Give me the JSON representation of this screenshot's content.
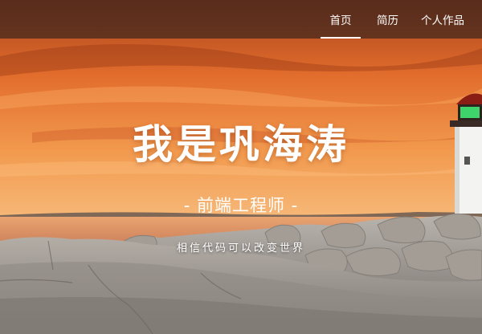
{
  "nav": {
    "items": [
      {
        "label": "首页",
        "active": true
      },
      {
        "label": "简历",
        "active": false
      },
      {
        "label": "个人作品",
        "active": false
      }
    ]
  },
  "hero": {
    "title": "我是巩海涛",
    "subtitle": "- 前端工程师 -",
    "tagline": "相信代码可以改变世界"
  },
  "colors": {
    "navbar_bg": "rgba(40,30,28,0.62)",
    "sky_top": "#b84a1e",
    "sky_mid": "#ef7f38",
    "sky_horizon": "#f7b166",
    "water": "#d88a5e",
    "rock": "#a9a9a6",
    "lighthouse": "#f3f3f1",
    "lamp": "#3fd36b"
  }
}
